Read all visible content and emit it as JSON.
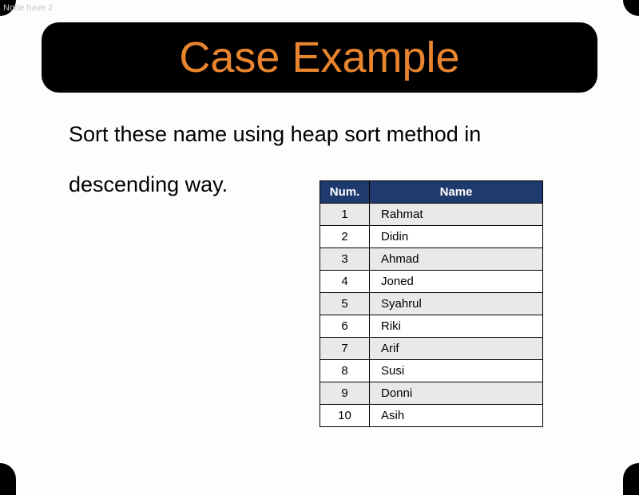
{
  "watermark": "Node have 2",
  "title": "Case Example",
  "instruction_line1": "Sort these name using heap sort method in",
  "instruction_line2": "descending way.",
  "table": {
    "headers": {
      "num": "Num.",
      "name": "Name"
    },
    "rows": [
      {
        "num": "1",
        "name": "Rahmat"
      },
      {
        "num": "2",
        "name": "Didin"
      },
      {
        "num": "3",
        "name": "Ahmad"
      },
      {
        "num": "4",
        "name": "Joned"
      },
      {
        "num": "5",
        "name": "Syahrul"
      },
      {
        "num": "6",
        "name": "Riki"
      },
      {
        "num": "7",
        "name": "Arif"
      },
      {
        "num": "8",
        "name": "Susi"
      },
      {
        "num": "9",
        "name": "Donni"
      },
      {
        "num": "10",
        "name": "Asih"
      }
    ]
  }
}
